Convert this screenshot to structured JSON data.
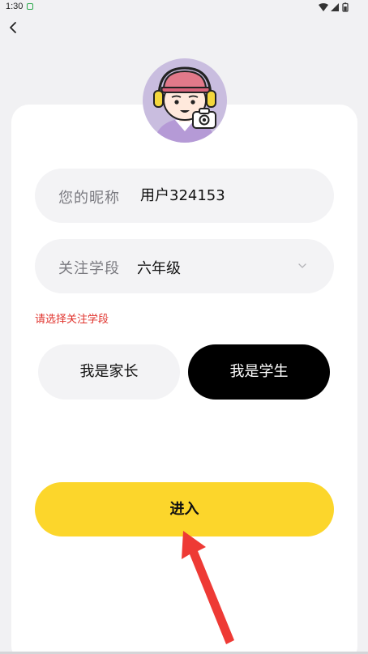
{
  "status_bar": {
    "time": "1:30"
  },
  "profile": {
    "nickname_label": "您的昵称",
    "nickname_value": "用户324153",
    "stage_label": "关注学段",
    "stage_value": "六年级",
    "stage_error": "请选择关注学段"
  },
  "roles": {
    "parent_label": "我是家长",
    "student_label": "我是学生",
    "selected": "student"
  },
  "actions": {
    "enter_label": "进入"
  },
  "colors": {
    "accent_yellow": "#fcd62b",
    "error_red": "#e0312b",
    "selected_role_bg": "#000000",
    "annotation_arrow": "#ee3a35"
  }
}
